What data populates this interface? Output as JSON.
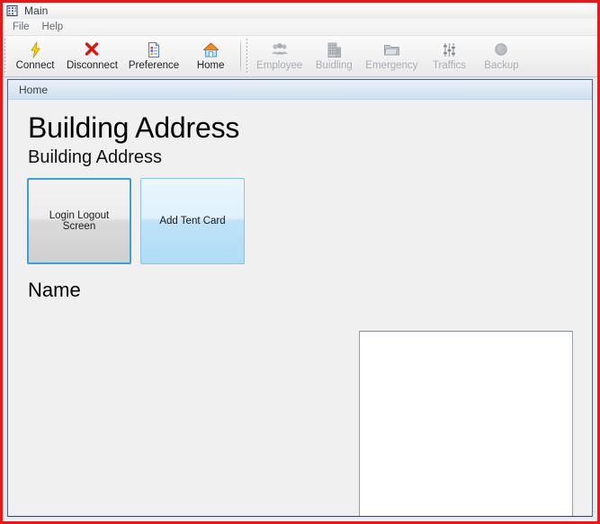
{
  "window": {
    "title": "Main",
    "icon": "building-grid-icon",
    "frame_color": "#e01b1b"
  },
  "menu": {
    "items": [
      {
        "label": "File",
        "name": "menu-file"
      },
      {
        "label": "Help",
        "name": "menu-help"
      }
    ]
  },
  "toolbar": {
    "enabled_group": [
      {
        "label": "Connect",
        "icon": "lightning-bolt-icon",
        "enabled": true
      },
      {
        "label": "Disconnect",
        "icon": "red-x-icon",
        "enabled": true
      },
      {
        "label": "Preference",
        "icon": "document-page-icon",
        "enabled": true
      },
      {
        "label": "Home",
        "icon": "house-icon",
        "enabled": true
      }
    ],
    "disabled_group": [
      {
        "label": "Employee",
        "icon": "people-icon",
        "enabled": false
      },
      {
        "label": "Buidling",
        "icon": "building-icon",
        "enabled": false
      },
      {
        "label": "Emergency",
        "icon": "folder-icon",
        "enabled": false
      },
      {
        "label": "Traffics",
        "icon": "sliders-icon",
        "enabled": false
      },
      {
        "label": "Backup",
        "icon": "disc-icon",
        "enabled": false
      }
    ]
  },
  "tab": {
    "active_label": "Home"
  },
  "page": {
    "heading": "Building Address",
    "subheading": "Building Address",
    "tiles": [
      {
        "label": "Login Logout Screen",
        "style": "gray",
        "name": "tile-login-logout-screen"
      },
      {
        "label": "Add Tent Card",
        "style": "blue",
        "name": "tile-add-tent-card"
      }
    ],
    "name_label": "Name",
    "display_panel": {
      "content": "",
      "background": "#ffffff"
    }
  },
  "colors": {
    "accent_blue": "#3f9fd4",
    "tile_blue": "#aedcf6",
    "client_surround": "#dde7f3",
    "page_background": "#eff0ef"
  }
}
